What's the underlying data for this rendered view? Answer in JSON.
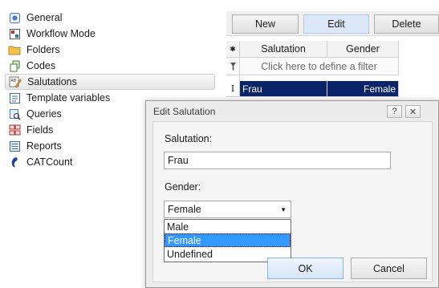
{
  "nav": {
    "items": [
      {
        "label": "General",
        "icon": "general-icon"
      },
      {
        "label": "Workflow Mode",
        "icon": "workflow-mode-icon"
      },
      {
        "label": "Folders",
        "icon": "folder-icon"
      },
      {
        "label": "Codes",
        "icon": "codes-icon"
      },
      {
        "label": "Salutations",
        "icon": "salutations-icon",
        "selected": true
      },
      {
        "label": "Template variables",
        "icon": "template-variables-icon"
      },
      {
        "label": "Queries",
        "icon": "queries-icon"
      },
      {
        "label": "Fields",
        "icon": "fields-icon"
      },
      {
        "label": "Reports",
        "icon": "reports-icon"
      },
      {
        "label": "CATCount",
        "icon": "catcount-icon"
      }
    ]
  },
  "toolbar": {
    "new_label": "New",
    "edit_label": "Edit",
    "delete_label": "Delete"
  },
  "grid": {
    "header_marker": "✱",
    "columns": [
      "Salutation",
      "Gender"
    ],
    "filter_text": "Click here to define a filter",
    "rows": [
      {
        "marker": "I",
        "salutation": "Frau",
        "gender": "Female",
        "selected": true
      }
    ]
  },
  "dialog": {
    "title": "Edit Salutation",
    "help_button": "?",
    "close_button": "✕",
    "salutation_label": "Salutation:",
    "salutation_value": "Frau",
    "gender_label": "Gender:",
    "gender_value": "Female",
    "gender_options": [
      "Male",
      "Female",
      "Undefined"
    ],
    "gender_selected_index": 1,
    "ok_label": "OK",
    "cancel_label": "Cancel"
  },
  "colors": {
    "selection_dark": "#0a246a",
    "dropdown_highlight": "#3399ff",
    "button_hot": "#dce8f7"
  }
}
